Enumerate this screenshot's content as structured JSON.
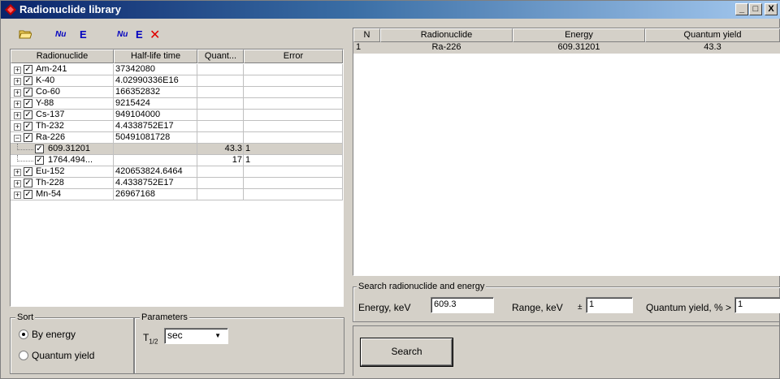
{
  "window": {
    "title": "Radionuclide library",
    "controls": [
      "_",
      "□",
      "X"
    ]
  },
  "toolbar": {
    "icons": [
      {
        "name": "open-folder-icon",
        "glyph": "🗁",
        "color": "#c8a000"
      },
      {
        "name": "add-nuclide-icon",
        "glyph": "Nu",
        "color": "#0000c0"
      },
      {
        "name": "add-energy-icon",
        "glyph": "E",
        "color": "#0000c0"
      },
      {
        "name": "remove-nuclide-icon",
        "glyph": "Nu",
        "color": "#0000c0"
      },
      {
        "name": "remove-energy-icon",
        "glyph": "E",
        "color": "#0000c0"
      },
      {
        "name": "delete-icon",
        "glyph": "✕",
        "color": "#e00000"
      }
    ]
  },
  "tree": {
    "headers": [
      "Radionuclide",
      "Half-life time",
      "Quant...",
      "Error"
    ],
    "rows": [
      {
        "expander": "+",
        "name": "Am-241",
        "halflife": "37342080",
        "quant": "",
        "error": "",
        "child": false,
        "selected": false
      },
      {
        "expander": "+",
        "name": "K-40",
        "halflife": "4.02990336E16",
        "quant": "",
        "error": "",
        "child": false,
        "selected": false
      },
      {
        "expander": "+",
        "name": "Co-60",
        "halflife": "166352832",
        "quant": "",
        "error": "",
        "child": false,
        "selected": false
      },
      {
        "expander": "+",
        "name": "Y-88",
        "halflife": "9215424",
        "quant": "",
        "error": "",
        "child": false,
        "selected": false
      },
      {
        "expander": "+",
        "name": "Cs-137",
        "halflife": "949104000",
        "quant": "",
        "error": "",
        "child": false,
        "selected": false
      },
      {
        "expander": "+",
        "name": "Th-232",
        "halflife": "4.4338752E17",
        "quant": "",
        "error": "",
        "child": false,
        "selected": false
      },
      {
        "expander": "−",
        "name": "Ra-226",
        "halflife": "50491081728",
        "quant": "",
        "error": "",
        "child": false,
        "selected": false
      },
      {
        "expander": "",
        "name": "609.31201",
        "halflife": "",
        "quant": "43.3",
        "error": "1",
        "child": true,
        "selected": true
      },
      {
        "expander": "",
        "name": "1764.494...",
        "halflife": "",
        "quant": "17",
        "error": "1",
        "child": true,
        "selected": false
      },
      {
        "expander": "+",
        "name": "Eu-152",
        "halflife": "420653824.6464",
        "quant": "",
        "error": "",
        "child": false,
        "selected": false
      },
      {
        "expander": "+",
        "name": "Th-228",
        "halflife": "4.4338752E17",
        "quant": "",
        "error": "",
        "child": false,
        "selected": false
      },
      {
        "expander": "+",
        "name": "Mn-54",
        "halflife": "26967168",
        "quant": "",
        "error": "",
        "child": false,
        "selected": false
      }
    ]
  },
  "sort": {
    "label": "Sort",
    "options": [
      "By energy",
      "Quantum yield"
    ],
    "selected": 0
  },
  "parameters": {
    "label": "Parameters",
    "t_label": "T",
    "t_sub": "1/2",
    "unit_value": "sec",
    "arrow": "▼"
  },
  "results": {
    "headers": [
      "N",
      "Radionuclide",
      "Energy",
      "Quantum yield"
    ],
    "rows": [
      {
        "n": "1",
        "nuclide": "Ra-226",
        "energy": "609.31201",
        "yield": "43.3"
      }
    ]
  },
  "search": {
    "group_label": "Search radionuclide and energy",
    "energy_label": "Energy, keV",
    "energy_value": "609.3",
    "range_label": "Range, keV",
    "range_prefix": "±",
    "range_value": "1",
    "yield_label": "Quantum yield, % >",
    "yield_value": "1",
    "button_label": "Search"
  },
  "colors": {
    "title_start": "#0a246a",
    "title_end": "#a6caf0",
    "selected_row": "#d4d0c8"
  }
}
